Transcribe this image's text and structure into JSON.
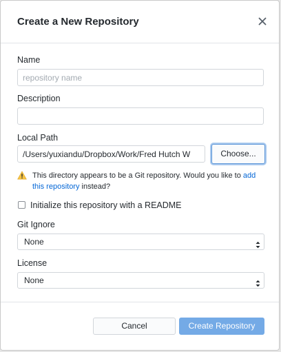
{
  "dialog": {
    "title": "Create a New Repository",
    "close_icon": "close-icon"
  },
  "form": {
    "name": {
      "label": "Name",
      "value": "",
      "placeholder": "repository name"
    },
    "description": {
      "label": "Description",
      "value": "",
      "placeholder": ""
    },
    "local_path": {
      "label": "Local Path",
      "value": "/Users/yuxiandu/Dropbox/Work/Fred Hutch W",
      "choose_label": "Choose..."
    },
    "warning": {
      "icon": "warning-icon",
      "text_before": "This directory appears to be a Git repository. Would you like to ",
      "link_text": "add this repository",
      "text_after": " instead?"
    },
    "init_readme": {
      "label": "Initialize this repository with a README",
      "checked": false
    },
    "git_ignore": {
      "label": "Git Ignore",
      "selected": "None"
    },
    "license": {
      "label": "License",
      "selected": "None"
    }
  },
  "footer": {
    "cancel_label": "Cancel",
    "create_label": "Create Repository"
  },
  "colors": {
    "accent": "#74aae6",
    "link": "#0366d6",
    "warning": "#f6c343"
  }
}
